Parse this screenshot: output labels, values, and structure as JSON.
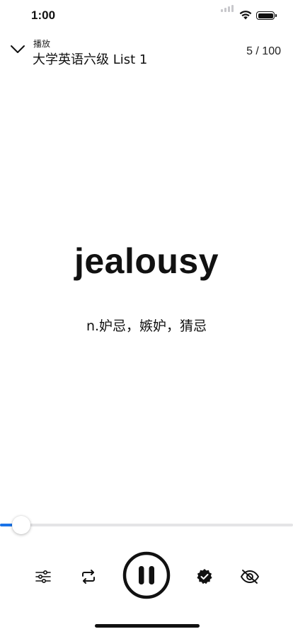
{
  "status_bar": {
    "time": "1:00"
  },
  "header": {
    "subtitle": "播放",
    "title": "大学英语六级 List 1",
    "page_counter": "5 / 100"
  },
  "card": {
    "word": "jealousy",
    "definition": "n.妒忌，嫉妒，猜忌"
  },
  "progress": {
    "fraction": 0.05
  },
  "icons": {
    "collapse": "chevron-down-icon",
    "settings": "sliders-icon",
    "repeat": "repeat-icon",
    "pause": "pause-icon",
    "verified": "verified-badge-icon",
    "hide": "eye-slash-icon"
  },
  "colors": {
    "accent": "#1a73e8",
    "primary": "#111111",
    "track": "#e4e4e6"
  }
}
